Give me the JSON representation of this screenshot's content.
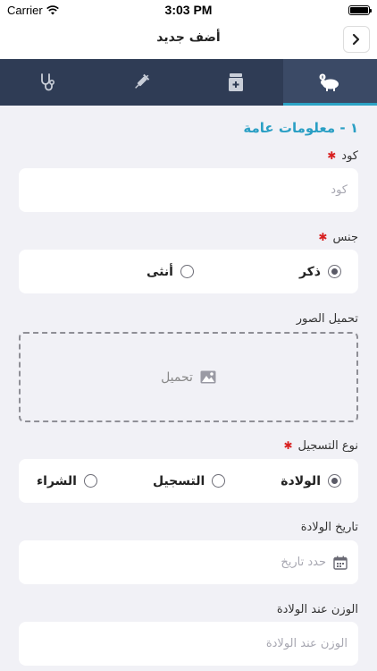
{
  "status": {
    "carrier": "Carrier",
    "time": "3:03 PM"
  },
  "nav": {
    "title": "أضف جديد"
  },
  "tabs": [
    {
      "icon": "sheep-info-icon",
      "active": true
    },
    {
      "icon": "medicine-box-icon",
      "active": false
    },
    {
      "icon": "syringe-icon",
      "active": false
    },
    {
      "icon": "stethoscope-icon",
      "active": false
    }
  ],
  "section": {
    "title": "١ - معلومات عامة"
  },
  "code": {
    "label": "كود",
    "placeholder": "كود"
  },
  "gender": {
    "label": "جنس",
    "options": [
      "ذكر",
      "أنثى"
    ],
    "selected": "ذكر"
  },
  "upload": {
    "label": "تحميل الصور",
    "button": "تحميل"
  },
  "registration": {
    "label": "نوع التسجيل",
    "options": [
      "الولادة",
      "التسجيل",
      "الشراء"
    ],
    "selected": "الولادة"
  },
  "birth_date": {
    "label": "تاريخ الولادة",
    "placeholder": "حدد تاريخ"
  },
  "birth_weight": {
    "label": "الوزن عند الولادة",
    "placeholder": "الوزن عند الولادة"
  },
  "colors": {
    "accent": "#2a9fc4",
    "tabbar": "#2f3c55",
    "required": "#d82020"
  }
}
